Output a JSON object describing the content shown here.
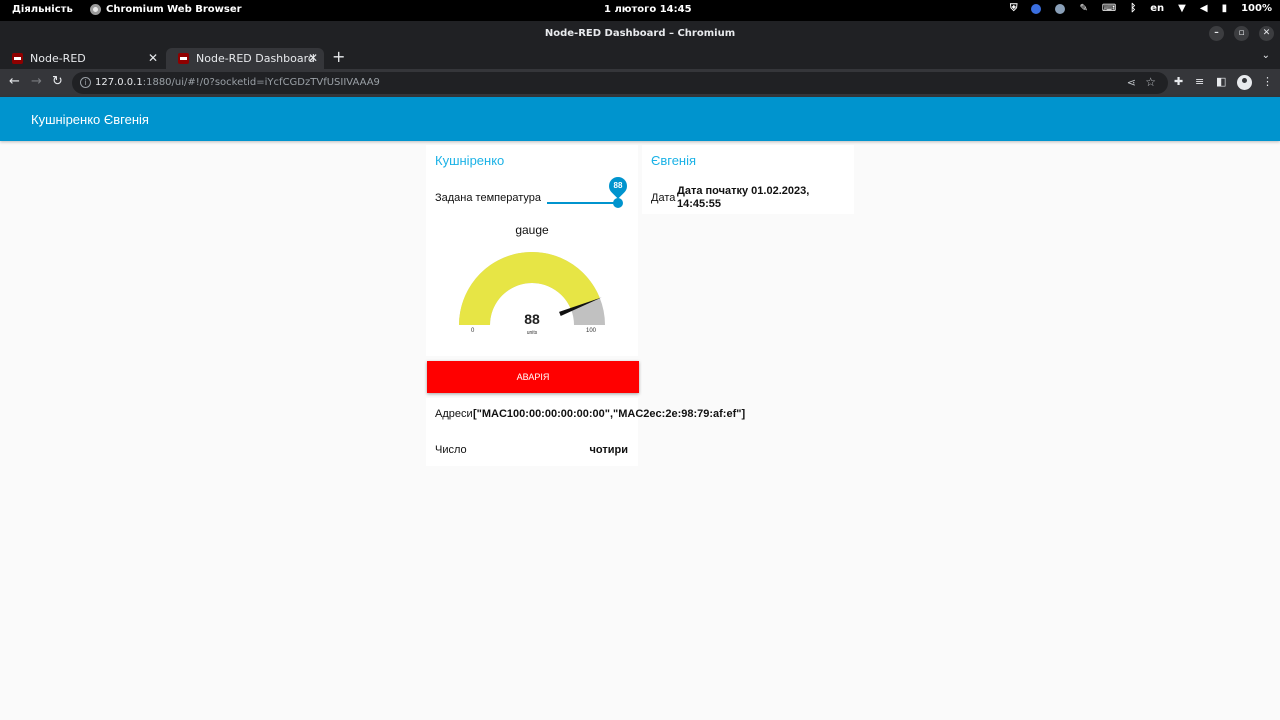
{
  "os": {
    "activities": "Діяльність",
    "app_name": "Chromium Web Browser",
    "clock": "1 лютого  14:45",
    "lang": "en",
    "battery": "100%"
  },
  "window": {
    "title": "Node-RED Dashboard – Chromium"
  },
  "tabs": [
    {
      "label": "Node-RED",
      "active": false
    },
    {
      "label": "Node-RED Dashboard",
      "active": true
    }
  ],
  "address_bar": {
    "host": "127.0.0.1",
    "path": ":1880/ui/#!/0?socketid=iYcfCGDzTVfUSIIVAAA9"
  },
  "dashboard": {
    "header_title": "Кушніренко Євгенія",
    "accent_color": "#0094ce",
    "group_left": {
      "title": "Кушніренко",
      "slider_label": "Задана температура",
      "slider_value": "88",
      "gauge": {
        "title": "gauge",
        "value": 88,
        "value_text": "88",
        "units": "units",
        "min": "0",
        "max": "100",
        "fill_color": "#e7e545",
        "bg_color": "#c1c1c1"
      },
      "alarm_button": "АВАРІЯ",
      "addresses_label": "Адреси",
      "addresses_value": "[\"MAC100:00:00:00:00:00\",\"MAC2ec:2e:98:79:af:ef\"]",
      "number_label": "Число",
      "number_value": "чотири"
    },
    "group_right": {
      "title": "Євгенія",
      "date_label": "Дата",
      "date_value_line1": "Дата початку 01.02.2023,",
      "date_value_line2": "14:45:55"
    }
  }
}
